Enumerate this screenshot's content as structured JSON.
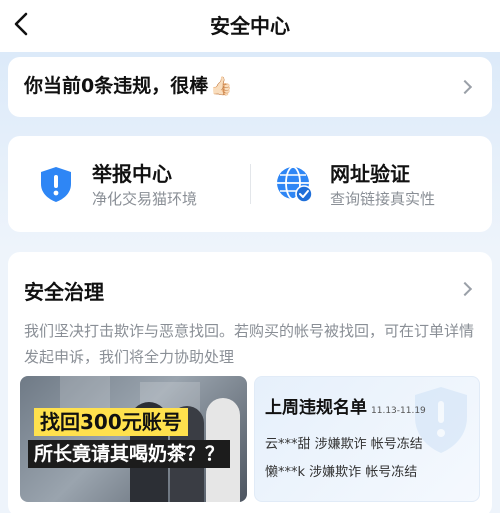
{
  "header": {
    "title": "安全中心",
    "back_icon": "chevron-left-icon"
  },
  "violation": {
    "text": "你当前0条违规，很棒",
    "emoji": "👍🏻"
  },
  "services": [
    {
      "title": "举报中心",
      "subtitle": "净化交易猫环境",
      "icon": "shield-exclamation-icon"
    },
    {
      "title": "网址验证",
      "subtitle": "查询链接真实性",
      "icon": "globe-check-icon"
    }
  ],
  "governance": {
    "title": "安全治理",
    "description": "我们坚决打击欺诈与恶意找回。若购买的帐号被找回，可在订单详情发起申诉，我们将全力协助处理",
    "promo": {
      "line1": "找回300元账号",
      "line2": "所长竟请其喝奶茶？？"
    },
    "blacklist": {
      "title": "上周违规名单",
      "date_range": "11.13-11.19",
      "rows": [
        "云***甜 涉嫌欺诈 帐号冻结",
        "懒***k 涉嫌欺诈 帐号冻结"
      ]
    }
  },
  "colors": {
    "accent": "#2e86f5",
    "background": "#eef4fb"
  }
}
